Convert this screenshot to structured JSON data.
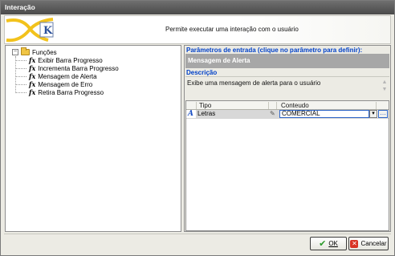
{
  "window": {
    "title": "Interação"
  },
  "header": {
    "description": "Permite executar uma interação com o usuário",
    "logo_letter": "K"
  },
  "tree": {
    "root_label": "Funções",
    "expander": "−",
    "items": [
      {
        "label": "Exibir Barra Progresso"
      },
      {
        "label": "Incrementa Barra Progresso"
      },
      {
        "label": "Mensagem de Alerta"
      },
      {
        "label": "Mensagem de Erro"
      },
      {
        "label": "Retira Barra Progresso"
      }
    ],
    "item_icon": "fx"
  },
  "params": {
    "caption": "Parâmetros de entrada (clique no parâmetro para definir):",
    "selected_function": "Mensagem de Alerta"
  },
  "description": {
    "caption": "Descrição",
    "text": "Exibe uma mensagem de alerta para o usuário"
  },
  "grid": {
    "columns": [
      "Tipo",
      "Conteudo"
    ],
    "rows": [
      {
        "icon": "A",
        "tipo": "Letras",
        "conteudo": "COMERCIAL"
      }
    ],
    "dropdown_glyph": "▾",
    "ellipsis_glyph": "…"
  },
  "buttons": {
    "ok": "OK",
    "cancel": "Cancelar"
  },
  "colors": {
    "accent": "#0040c8",
    "selected_param_bg": "#a7a7a7",
    "titlebar": "#5a5a5a"
  }
}
